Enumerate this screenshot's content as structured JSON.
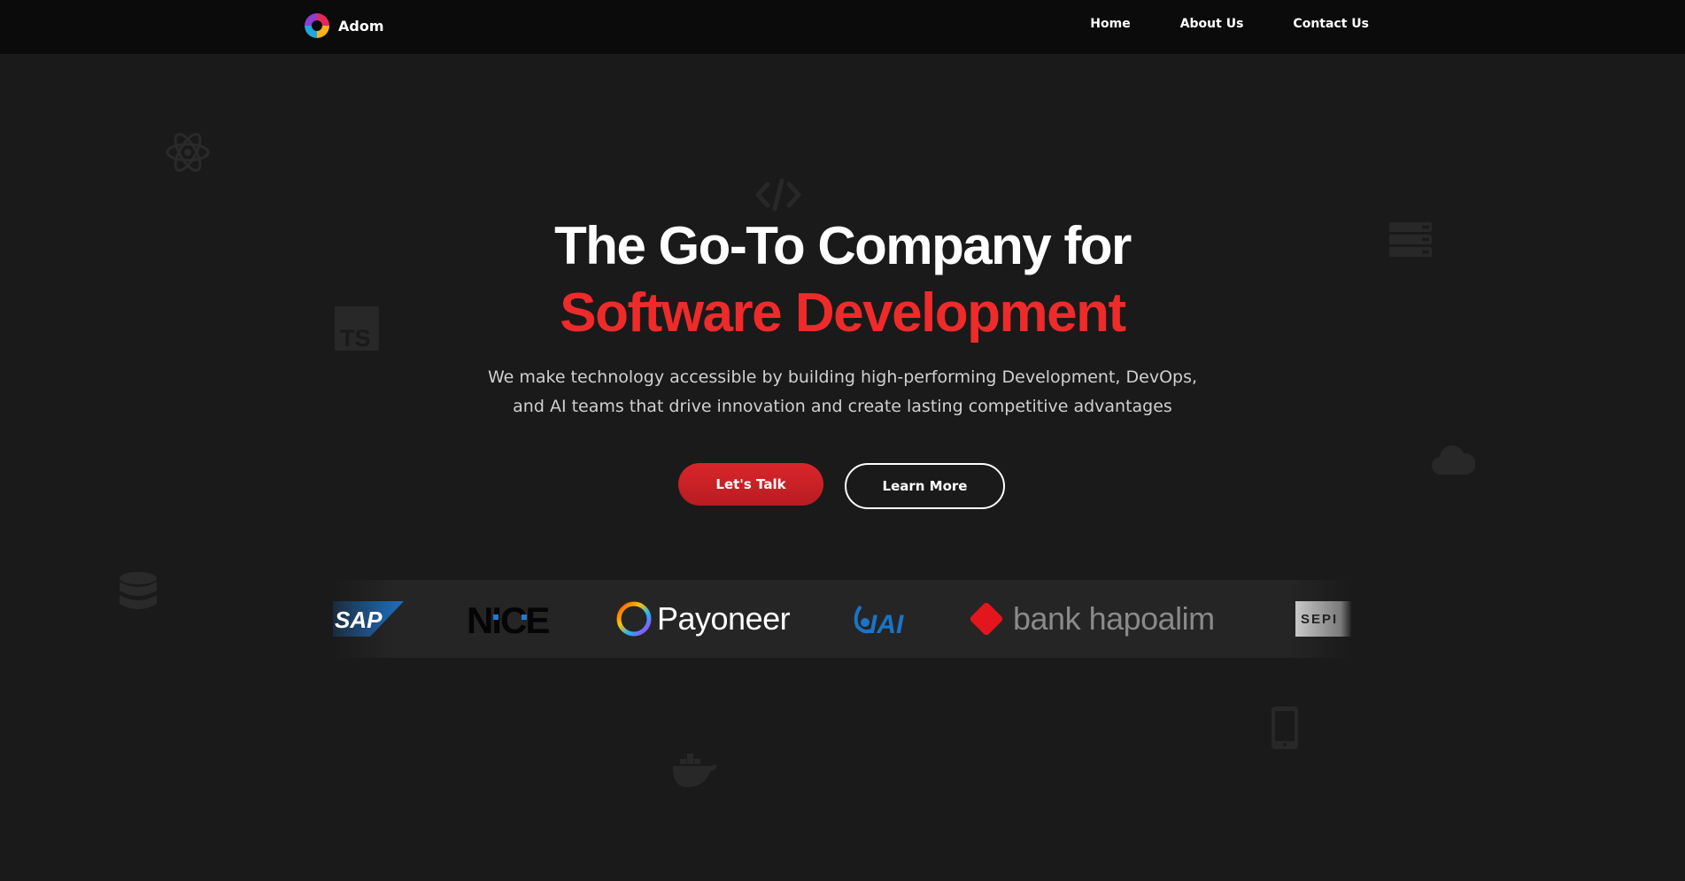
{
  "nav": {
    "brand": "Adom",
    "links": [
      "Home",
      "About Us",
      "Contact Us"
    ]
  },
  "hero": {
    "title_line1": "The Go-To Company for",
    "title_line2": "Software Development",
    "subtitle_line1": "We make technology accessible by building high-performing Development, DevOps,",
    "subtitle_line2": "and AI teams that drive innovation and create lasting competitive advantages",
    "primary_button": "Let's Talk",
    "secondary_button": "Learn More"
  },
  "clients": {
    "logos": [
      "SAP",
      "NICE",
      "Payoneer",
      "IAI",
      "bank hapoalim",
      "SEPI"
    ]
  },
  "background_icons": [
    "react-icon",
    "code-icon",
    "server-icon",
    "typescript-icon",
    "cloud-icon",
    "database-icon",
    "mobile-icon",
    "docker-icon"
  ],
  "colors": {
    "background": "#1a1a1a",
    "nav": "#0b0b0b",
    "accent": "#ef2a2a",
    "button": "#d9262b"
  }
}
